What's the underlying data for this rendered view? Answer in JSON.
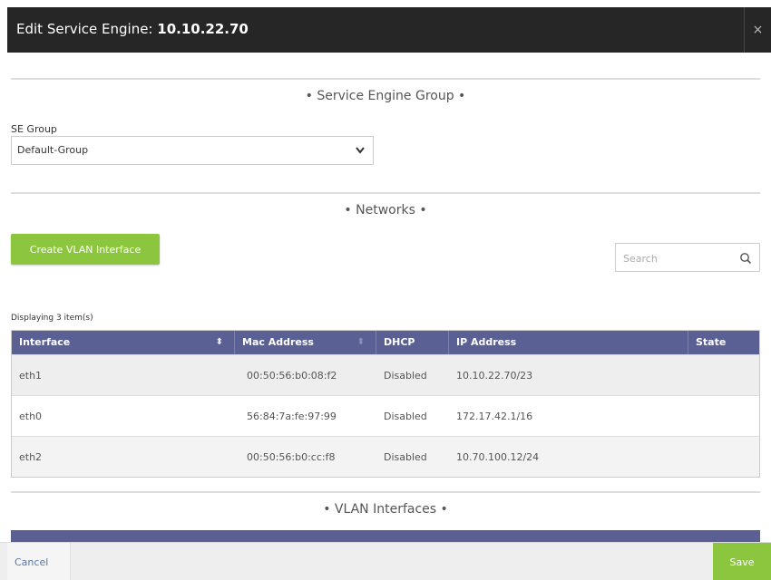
{
  "header": {
    "title_prefix": "Edit Service Engine: ",
    "title_ip": "10.10.22.70",
    "close_glyph": "×"
  },
  "sections": {
    "se_group": "• Service Engine Group •",
    "networks": "• Networks •",
    "vlan_interfaces": "• VLAN Interfaces •"
  },
  "se_group": {
    "label": "SE Group",
    "value": "Default-Group",
    "icon": "chevron-down-icon"
  },
  "networks": {
    "create_vlan_label": "Create VLAN Interface",
    "search_placeholder": "Search",
    "search_icon": "search-icon",
    "displaying": "Displaying 3 item(s)",
    "columns": [
      "Interface",
      "Mac Address",
      "DHCP",
      "IP Address",
      "State"
    ],
    "rows": [
      {
        "interface": "eth1",
        "mac": "00:50:56:b0:08:f2",
        "dhcp": "Disabled",
        "ip": "10.10.22.70/23",
        "state": ""
      },
      {
        "interface": "eth0",
        "mac": "56:84:7a:fe:97:99",
        "dhcp": "Disabled",
        "ip": "172.17.42.1/16",
        "state": ""
      },
      {
        "interface": "eth2",
        "mac": "00:50:56:b0:cc:f8",
        "dhcp": "Disabled",
        "ip": "10.70.100.12/24",
        "state": ""
      }
    ]
  },
  "footer": {
    "cancel_label": "Cancel",
    "save_label": "Save"
  },
  "colors": {
    "titlebar": "#262626",
    "table_header": "#5a5f94",
    "accent_green": "#8cc63f",
    "link_blue": "#5a76a8"
  }
}
